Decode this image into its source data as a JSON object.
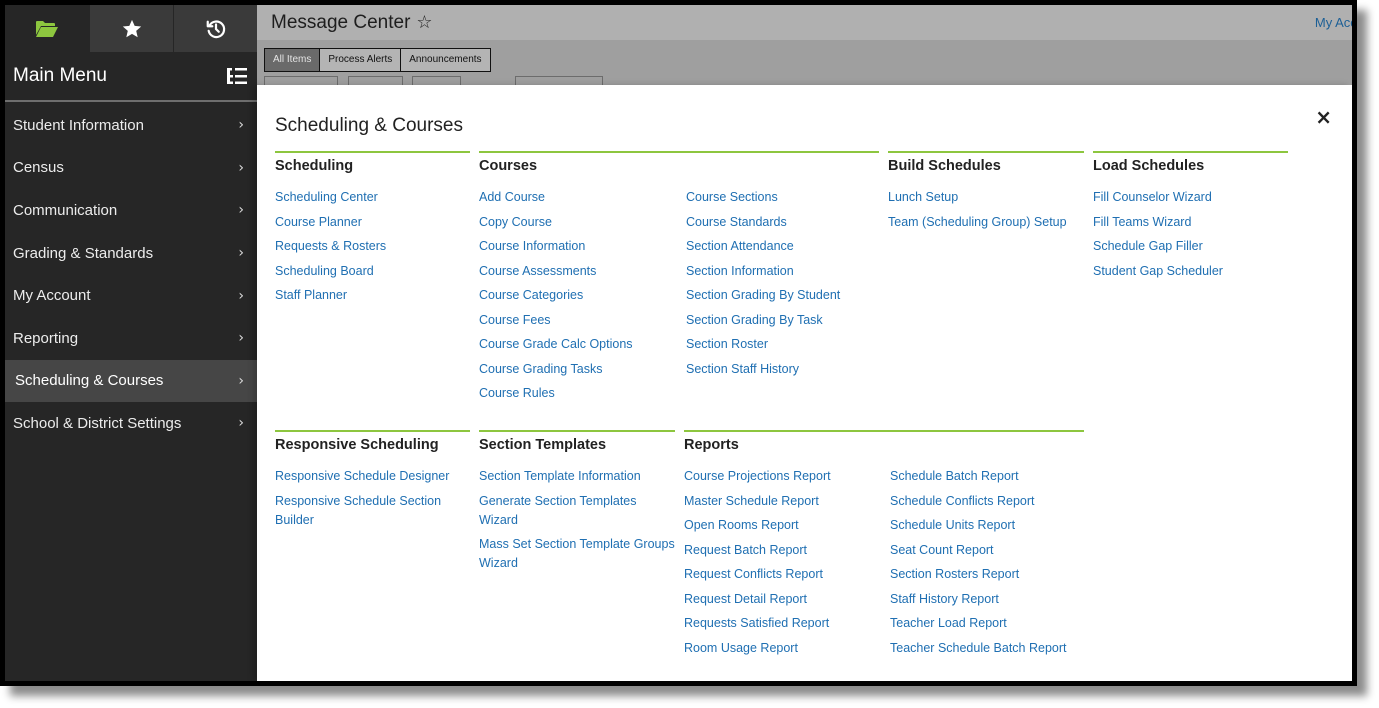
{
  "sidebar": {
    "tabs": [
      {
        "icon": "folder-icon",
        "active": true
      },
      {
        "icon": "star-icon",
        "active": false
      },
      {
        "icon": "history-icon",
        "active": false
      }
    ],
    "title": "Main Menu",
    "items": [
      {
        "label": "Student Information"
      },
      {
        "label": "Census"
      },
      {
        "label": "Communication"
      },
      {
        "label": "Grading & Standards"
      },
      {
        "label": "My Account"
      },
      {
        "label": "Reporting"
      },
      {
        "label": "Scheduling & Courses",
        "active": true
      },
      {
        "label": "School & District Settings"
      }
    ]
  },
  "header": {
    "title": "Message Center",
    "account_link": "My Acco"
  },
  "toolbar": {
    "tabs": [
      "All Items",
      "Process Alerts",
      "Announcements"
    ],
    "active_tab": "All Items"
  },
  "panel": {
    "title": "Scheduling & Courses",
    "close_label": "×",
    "groups": {
      "scheduling": {
        "heading": "Scheduling",
        "links": [
          "Scheduling Center",
          "Course Planner",
          "Requests & Rosters",
          "Scheduling Board",
          "Staff Planner"
        ]
      },
      "courses": {
        "heading": "Courses",
        "links_col1": [
          "Add Course",
          "Copy Course",
          "Course Information",
          "Course Assessments",
          "Course Categories",
          "Course Fees",
          "Course Grade Calc Options",
          "Course Grading Tasks",
          "Course Rules"
        ],
        "links_col2": [
          "Course Sections",
          "Course Standards",
          "Section Attendance",
          "Section Information",
          "Section Grading By Student",
          "Section Grading By Task",
          "Section Roster",
          "Section Staff History"
        ]
      },
      "build_schedules": {
        "heading": "Build Schedules",
        "links": [
          "Lunch Setup",
          "Team (Scheduling Group) Setup"
        ]
      },
      "load_schedules": {
        "heading": "Load Schedules",
        "links": [
          "Fill Counselor Wizard",
          "Fill Teams Wizard",
          "Schedule Gap Filler",
          "Student Gap Scheduler"
        ]
      },
      "responsive_scheduling": {
        "heading": "Responsive Scheduling",
        "links": [
          "Responsive Schedule Designer",
          "Responsive Schedule Section Builder"
        ]
      },
      "section_templates": {
        "heading": "Section Templates",
        "links": [
          "Section Template Information",
          "Generate Section Templates Wizard",
          "Mass Set Section Template Groups Wizard"
        ]
      },
      "reports": {
        "heading": "Reports",
        "links_col1": [
          "Course Projections Report",
          "Master Schedule Report",
          "Open Rooms Report",
          "Request Batch Report",
          "Request Conflicts Report",
          "Request Detail Report",
          "Requests Satisfied Report",
          "Room Usage Report"
        ],
        "links_col2": [
          "Schedule Batch Report",
          "Schedule Conflicts Report",
          "Schedule Units Report",
          "Seat Count Report",
          "Section Rosters Report",
          "Staff History Report",
          "Teacher Load Report",
          "Teacher Schedule Batch Report"
        ]
      }
    }
  },
  "colors": {
    "sidebar_bg": "#262626",
    "sidebar_active": "#464646",
    "accent_green": "#8dc63f",
    "link_blue": "#1f6fb2"
  }
}
